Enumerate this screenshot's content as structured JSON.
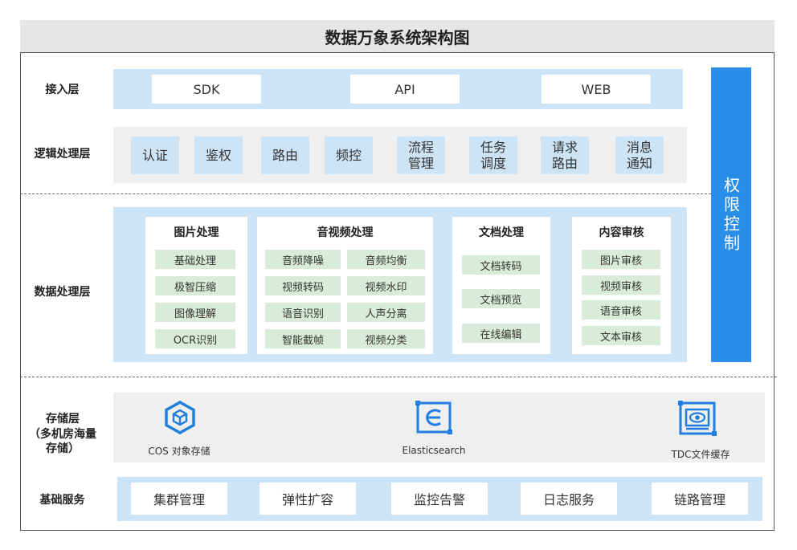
{
  "title": "数据万象系统架构图",
  "layers": {
    "access": {
      "label": "接入层",
      "items": [
        "SDK",
        "API",
        "WEB"
      ]
    },
    "logic": {
      "label": "逻辑处理层",
      "items": [
        "认证",
        "鉴权",
        "路由",
        "频控",
        "流程\n管理",
        "任务\n调度",
        "请求\n路由",
        "消息\n通知"
      ]
    },
    "data": {
      "label": "数据处理层",
      "panels": [
        {
          "title": "图片处理",
          "items": [
            "基础处理",
            "极智压缩",
            "图像理解",
            "OCR识别"
          ]
        },
        {
          "title": "音视频处理",
          "items": [
            "音频降噪",
            "音频均衡",
            "视频转码",
            "视频水印",
            "语音识别",
            "人声分离",
            "智能截帧",
            "视频分类"
          ]
        },
        {
          "title": "文档处理",
          "items": [
            "文档转码",
            "文档预览",
            "在线编辑"
          ]
        },
        {
          "title": "内容审核",
          "items": [
            "图片审核",
            "视频审核",
            "语音审核",
            "文本审核"
          ]
        }
      ]
    },
    "storage": {
      "label": "存储层\n（多机房海量\n存储）",
      "items": [
        {
          "label": "COS 对象存储",
          "icon": "cos-hexagon-cube-icon"
        },
        {
          "label": "Elasticsearch",
          "icon": "elasticsearch-icon"
        },
        {
          "label": "TDC文件缓存",
          "icon": "tdc-eye-icon"
        }
      ]
    },
    "base": {
      "label": "基础服务",
      "items": [
        "集群管理",
        "弹性扩容",
        "监控告警",
        "日志服务",
        "链路管理"
      ]
    }
  },
  "permission": "权限控制",
  "colors": {
    "accent_blue": "#2a8ee8",
    "light_blue": "#cce4f6",
    "light_gray": "#efefef",
    "light_green": "#d9ecd9"
  }
}
